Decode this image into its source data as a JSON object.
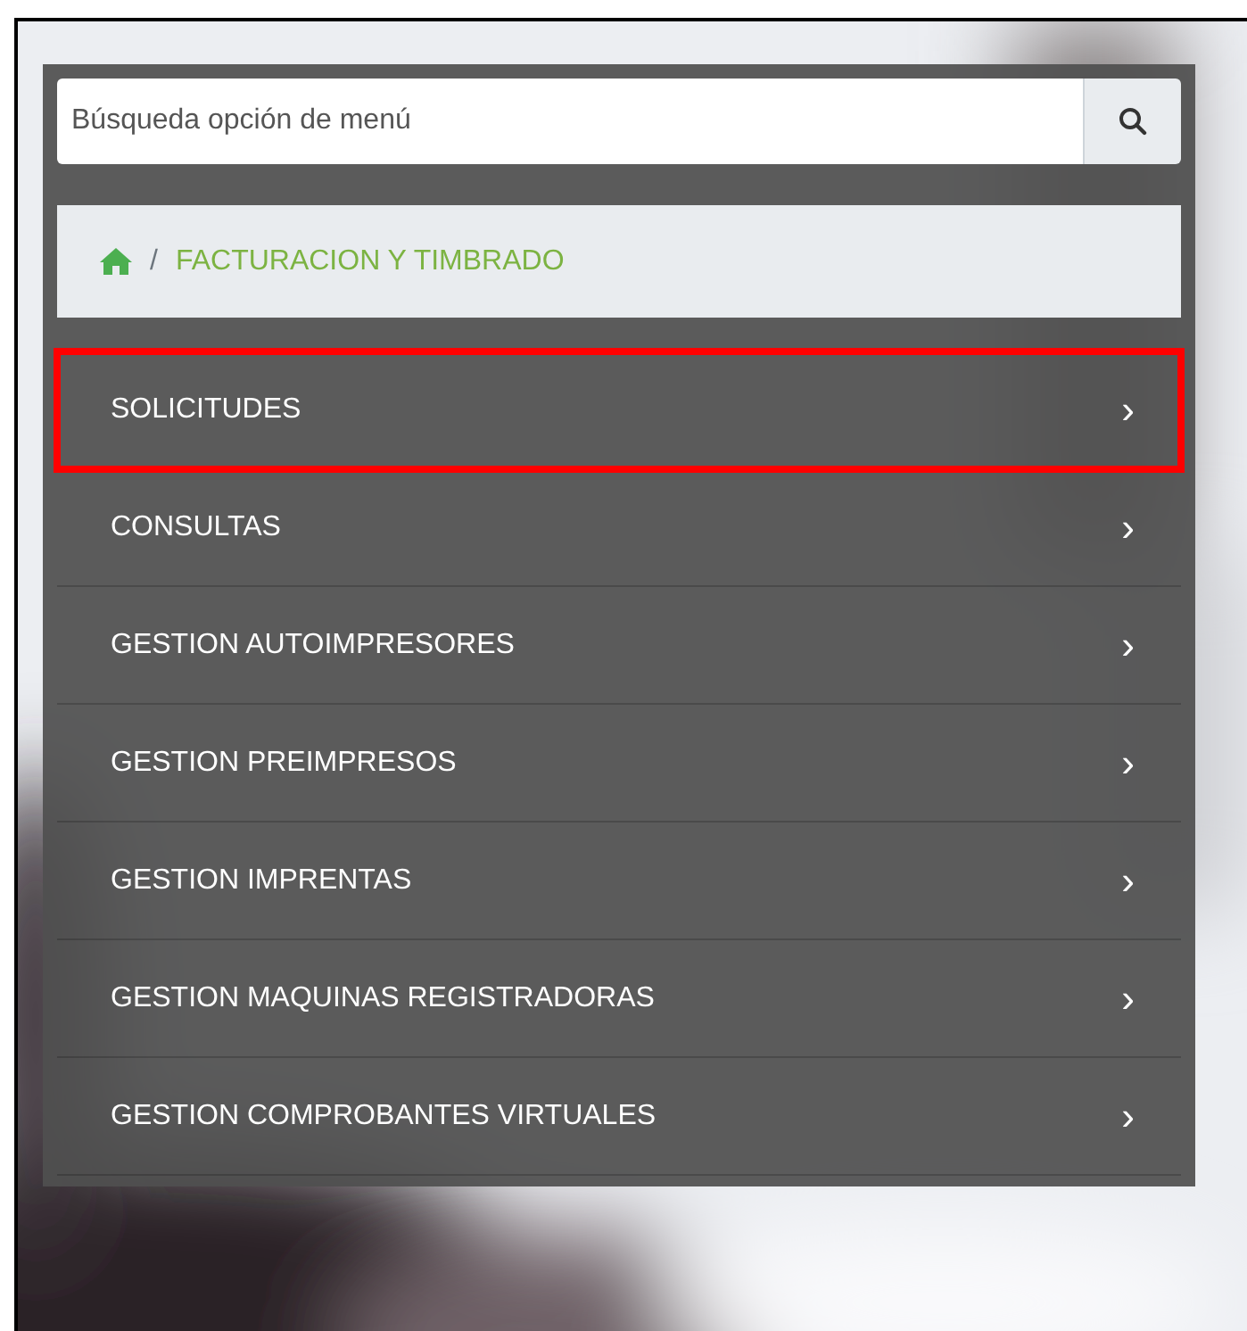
{
  "search": {
    "placeholder": "Búsqueda opción de menú"
  },
  "breadcrumb": {
    "separator": "/",
    "current": "FACTURACION Y TIMBRADO"
  },
  "menu": [
    {
      "label": "SOLICITUDES",
      "chevron": "›",
      "highlighted": true
    },
    {
      "label": "CONSULTAS",
      "chevron": "›",
      "highlighted": false
    },
    {
      "label": "GESTION AUTOIMPRESORES",
      "chevron": "›",
      "highlighted": false
    },
    {
      "label": "GESTION PREIMPRESOS",
      "chevron": "›",
      "highlighted": false
    },
    {
      "label": "GESTION IMPRENTAS",
      "chevron": "›",
      "highlighted": false
    },
    {
      "label": "GESTION MAQUINAS REGISTRADORAS",
      "chevron": "›",
      "highlighted": false
    },
    {
      "label": "GESTION COMPROBANTES VIRTUALES",
      "chevron": "›",
      "highlighted": false
    }
  ]
}
